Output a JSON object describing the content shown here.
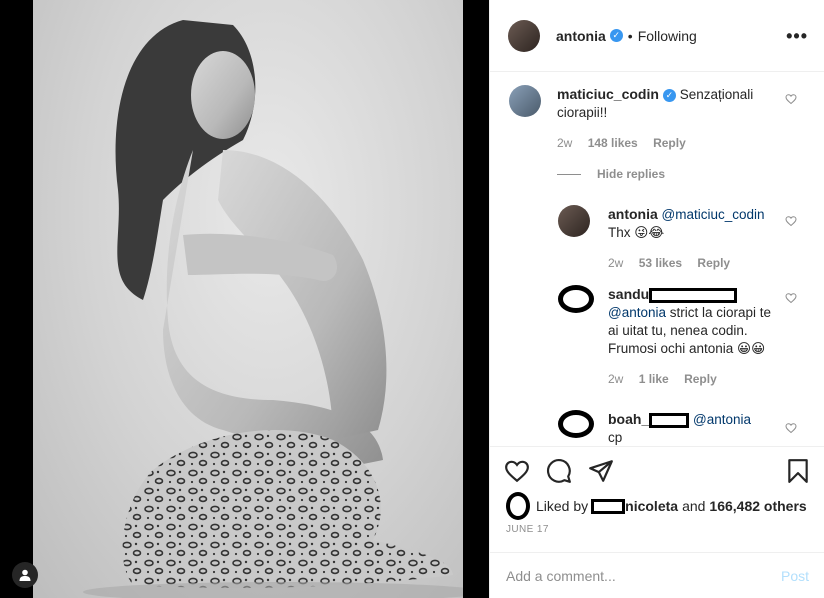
{
  "post": {
    "author": "antonia",
    "follow_state": "Following",
    "separator": "•",
    "more": "•••"
  },
  "comments": [
    {
      "username": "maticiuc_codin",
      "text": "Senzaționali ciorapii!!",
      "age": "2w",
      "likes": "148 likes",
      "reply": "Reply"
    }
  ],
  "hide_replies": "Hide replies",
  "replies": [
    {
      "username": "antonia",
      "mention": "@maticiuc_codin",
      "text": "Thx 😜😂",
      "age": "2w",
      "likes": "53 likes",
      "reply": "Reply"
    },
    {
      "username": "sandu",
      "mention": "@antonia",
      "text": "strict la ciorapi te ai uitat tu, nenea codin. Frumosi ochi antonia 😀😀",
      "age": "2w",
      "likes": "1 like",
      "reply": "Reply"
    },
    {
      "username": "boah_",
      "mention": "@antonia",
      "text": "cp"
    }
  ],
  "liked_by": {
    "prefix": "Liked by",
    "user_suffix": "nicoleta",
    "conjunction": "and",
    "others": "166,482 others"
  },
  "date": "JUNE 17",
  "add_comment": {
    "placeholder": "Add a comment...",
    "post_label": "Post"
  },
  "colors": {
    "verified": "#3897f0",
    "mention": "#00376b",
    "post_disabled": "#b2dffc",
    "meta": "#8e8e8e"
  },
  "icons": [
    "heart-icon",
    "comment-icon",
    "share-icon",
    "bookmark-icon",
    "user-tag-icon",
    "verified-icon",
    "more-icon"
  ]
}
